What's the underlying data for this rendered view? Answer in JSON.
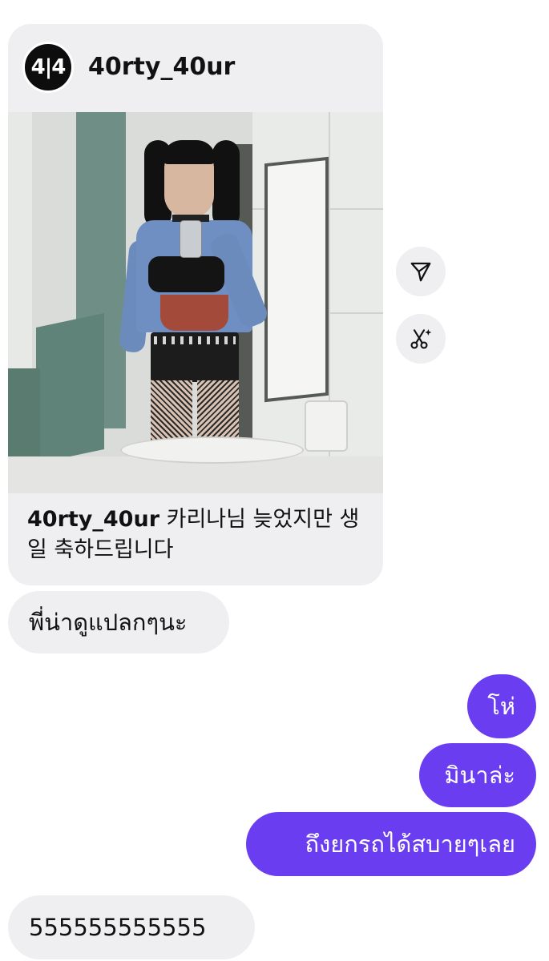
{
  "shared_post": {
    "username": "40rty_40ur",
    "avatar_text": "4|4",
    "caption_username": "40rty_40ur",
    "caption_text": "카리나님 늦었지만 생일 축하드립니다",
    "photo_description_icon": "mirror-selfie-photo"
  },
  "side_actions": {
    "share_icon": "send-icon",
    "remix_icon": "scissors-sparkle-icon"
  },
  "messages": [
    {
      "direction": "received",
      "text": "พี่น่าดูแปลกๆนะ"
    },
    {
      "direction": "sent",
      "text": "โห่"
    },
    {
      "direction": "sent",
      "text": "มินาล่ะ"
    },
    {
      "direction": "sent",
      "text": "ถึงยกรถได้สบายๆเลย"
    },
    {
      "direction": "received",
      "text": "555555555555"
    }
  ],
  "colors": {
    "sent_bubble": "#6a3ef0",
    "received_bubble": "#efeff2",
    "background": "#ffffff"
  }
}
